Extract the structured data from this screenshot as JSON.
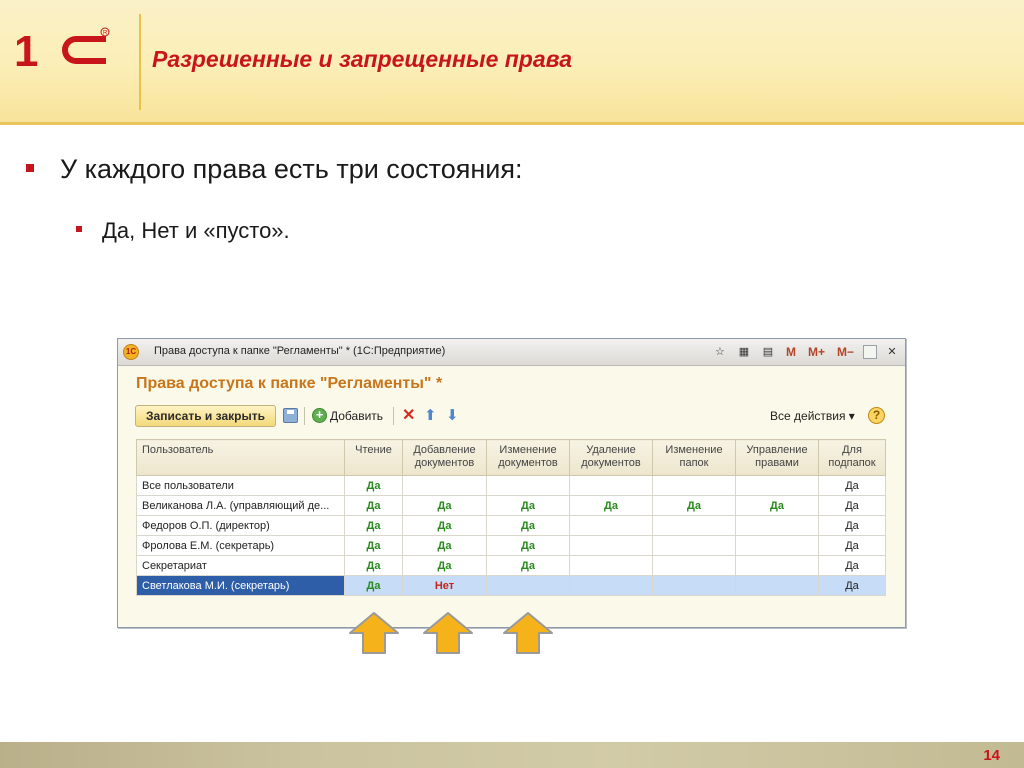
{
  "slide": {
    "title": "Разрешенные и запрещенные права",
    "bullet1": "У каждого права есть три состояния:",
    "bullet2": "Да, Нет и «пусто».",
    "page_number": "14",
    "logo_text": "1С"
  },
  "window": {
    "title": "Права доступа к папке \"Регламенты\" * (1С:Предприятие)",
    "form_title": "Права доступа к папке \"Регламенты\" *",
    "titlebar_buttons": [
      "M",
      "M+",
      "M−"
    ],
    "toolbar": {
      "save_close_label": "Записать и закрыть",
      "add_label": "Добавить",
      "all_actions_label": "Все действия ▾",
      "help_label": "?"
    },
    "columns": [
      "Пользователь",
      "Чтение",
      "Добавление документов",
      "Изменение документов",
      "Удаление документов",
      "Изменение папок",
      "Управление правами",
      "Для подпапок"
    ],
    "rows": [
      [
        "Все пользователи",
        "Да",
        "",
        "",
        "",
        "",
        "",
        "Да"
      ],
      [
        "Великанова Л.А. (управляющий де...",
        "Да",
        "Да",
        "Да",
        "Да",
        "Да",
        "Да",
        "Да"
      ],
      [
        "Федоров О.П. (директор)",
        "Да",
        "Да",
        "Да",
        "",
        "",
        "",
        "Да"
      ],
      [
        "Фролова Е.М. (секретарь)",
        "Да",
        "Да",
        "Да",
        "",
        "",
        "",
        "Да"
      ],
      [
        "Секретариат",
        "Да",
        "Да",
        "Да",
        "",
        "",
        "",
        "Да"
      ],
      [
        "Светлакова М.И. (секретарь)",
        "Да",
        "Нет",
        "",
        "",
        "",
        "",
        "Да"
      ]
    ],
    "selected_row": 5,
    "colors": {
      "yes": "#2a8a1e",
      "no": "#c7231c",
      "selection": "#2f5ea8",
      "title_red": "#c8151b",
      "form_title_orange": "#c8761b"
    }
  }
}
